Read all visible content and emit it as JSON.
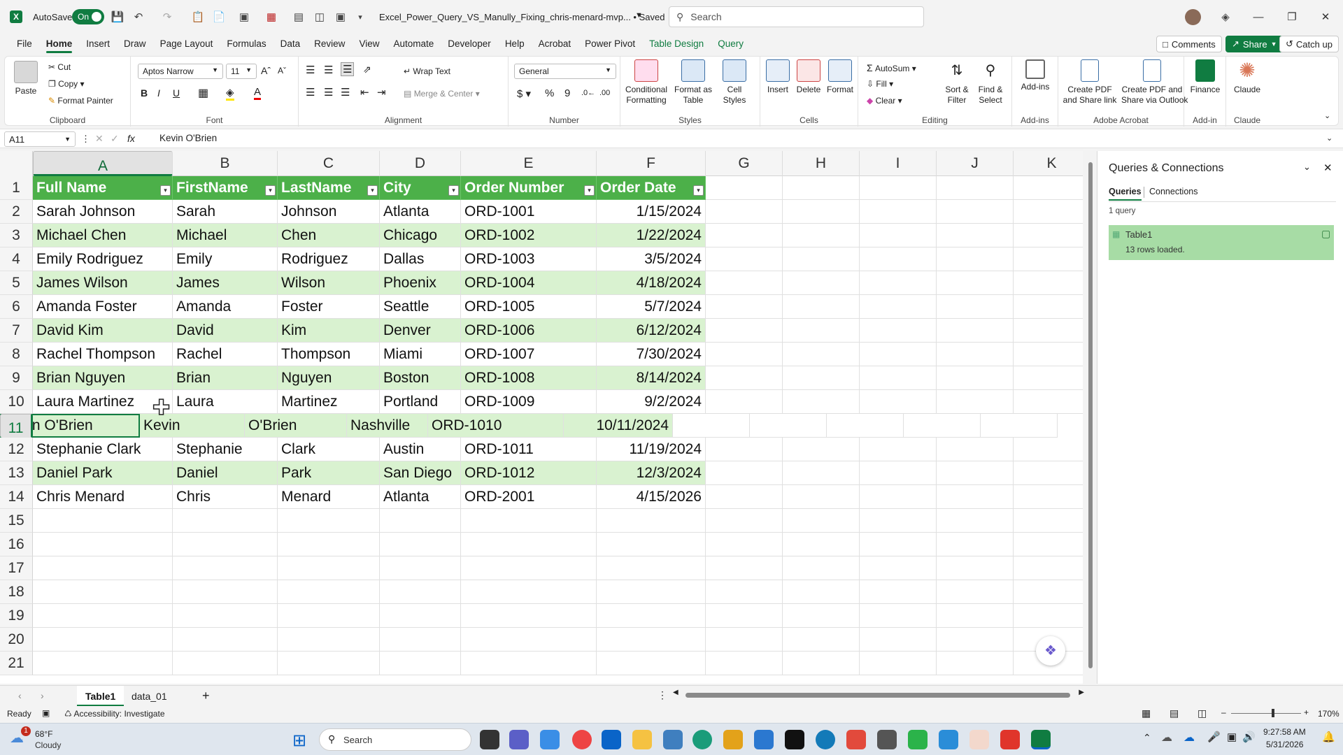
{
  "titlebar": {
    "autosave_label": "AutoSave",
    "autosave_state": "On",
    "filename": "Excel_Power_Query_VS_Manully_Fixing_chris-menard-mvp... • Saved",
    "search_placeholder": "Search"
  },
  "menu": {
    "tabs": [
      "File",
      "Home",
      "Insert",
      "Draw",
      "Page Layout",
      "Formulas",
      "Data",
      "Review",
      "View",
      "Automate",
      "Developer",
      "Help",
      "Acrobat",
      "Power Pivot",
      "Table Design",
      "Query"
    ],
    "comments": "Comments",
    "share": "Share",
    "catchup": "Catch up"
  },
  "ribbon": {
    "clipboard": {
      "paste": "Paste",
      "cut": "Cut",
      "copy": "Copy",
      "format_painter": "Format Painter",
      "label": "Clipboard"
    },
    "font": {
      "name": "Aptos Narrow",
      "size": "11",
      "label": "Font"
    },
    "alignment": {
      "wrap": "Wrap Text",
      "merge": "Merge & Center",
      "label": "Alignment"
    },
    "number": {
      "format": "General",
      "label": "Number"
    },
    "styles": {
      "cond1": "Conditional",
      "cond2": "Formatting",
      "fmt1": "Format as",
      "fmt2": "Table",
      "cell1": "Cell",
      "cell2": "Styles",
      "label": "Styles"
    },
    "cells": {
      "insert": "Insert",
      "delete": "Delete",
      "format": "Format",
      "label": "Cells"
    },
    "editing": {
      "autosum": "AutoSum",
      "fill": "Fill",
      "clear": "Clear",
      "sort1": "Sort &",
      "sort2": "Filter",
      "find1": "Find &",
      "find2": "Select",
      "label": "Editing"
    },
    "addins": {
      "btn": "Add-ins",
      "label": "Add-ins"
    },
    "acrobat": {
      "a1": "Create PDF",
      "a2": "and Share link",
      "b1": "Create PDF and",
      "b2": "Share via Outlook",
      "label": "Adobe Acrobat"
    },
    "finance": {
      "btn": "Finance",
      "label": "Add-in"
    },
    "claude": {
      "btn": "Claude",
      "label": "Claude"
    }
  },
  "formula_bar": {
    "name_box": "A11",
    "fx": "fx",
    "content": "Kevin O'Brien"
  },
  "grid": {
    "columns": [
      "A",
      "B",
      "C",
      "D",
      "E",
      "F",
      "G",
      "H",
      "I",
      "J",
      "K"
    ],
    "header": [
      "Full Name",
      "FirstName",
      "LastName",
      "City",
      "Order Number",
      "Order Date"
    ],
    "rows": [
      [
        "Sarah Johnson",
        "Sarah",
        "Johnson",
        "Atlanta",
        "ORD-1001",
        "1/15/2024"
      ],
      [
        "Michael Chen",
        "Michael",
        "Chen",
        "Chicago",
        "ORD-1002",
        "1/22/2024"
      ],
      [
        "Emily Rodriguez",
        "Emily",
        "Rodriguez",
        "Dallas",
        "ORD-1003",
        "3/5/2024"
      ],
      [
        "James Wilson",
        "James",
        "Wilson",
        "Phoenix",
        "ORD-1004",
        "4/18/2024"
      ],
      [
        "Amanda Foster",
        "Amanda",
        "Foster",
        "Seattle",
        "ORD-1005",
        "5/7/2024"
      ],
      [
        "David Kim",
        "David",
        "Kim",
        "Denver",
        "ORD-1006",
        "6/12/2024"
      ],
      [
        "Rachel Thompson",
        "Rachel",
        "Thompson",
        "Miami",
        "ORD-1007",
        "7/30/2024"
      ],
      [
        "Brian Nguyen",
        "Brian",
        "Nguyen",
        "Boston",
        "ORD-1008",
        "8/14/2024"
      ],
      [
        "Laura Martinez",
        "Laura",
        "Martinez",
        "Portland",
        "ORD-1009",
        "9/2/2024"
      ],
      [
        "Kevin O'Brien",
        "Kevin",
        "O'Brien",
        "Nashville",
        "ORD-1010",
        "10/11/2024"
      ],
      [
        "Stephanie Clark",
        "Stephanie",
        "Clark",
        "Austin",
        "ORD-1011",
        "11/19/2024"
      ],
      [
        "Daniel Park",
        "Daniel",
        "Park",
        "San Diego",
        "ORD-1012",
        "12/3/2024"
      ],
      [
        "Chris Menard",
        "Chris",
        "Menard",
        "Atlanta",
        "ORD-2001",
        "4/15/2026"
      ]
    ],
    "row_numbers": [
      "1",
      "2",
      "3",
      "4",
      "5",
      "6",
      "7",
      "8",
      "9",
      "10",
      "11",
      "12",
      "13",
      "14",
      "15",
      "16",
      "17",
      "18",
      "19",
      "20",
      "21"
    ]
  },
  "pane": {
    "title": "Queries & Connections",
    "tab_queries": "Queries",
    "tab_connections": "Connections",
    "count": "1 query",
    "query_name": "Table1",
    "query_status": "13 rows loaded."
  },
  "sheets": {
    "tabs": [
      "Table1",
      "data_01"
    ]
  },
  "status": {
    "ready": "Ready",
    "accessibility": "Accessibility: Investigate",
    "zoom": "170%"
  },
  "taskbar": {
    "temp": "68°F",
    "weather": "Cloudy",
    "search": "Search",
    "time": "9:27:58 AM",
    "date": "5/31/2026",
    "badge": "1"
  }
}
